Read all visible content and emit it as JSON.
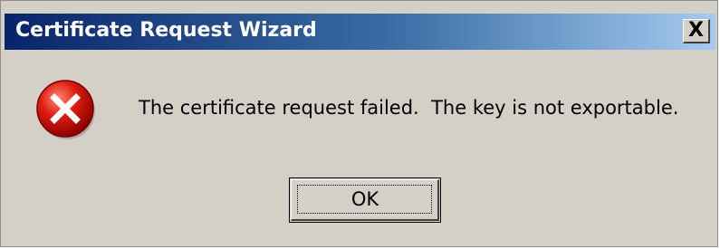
{
  "window": {
    "title": "Certificate Request Wizard",
    "close_glyph": "X"
  },
  "icon": {
    "name": "error-icon",
    "color": "#cc0000"
  },
  "message": {
    "text": "The certificate request failed.  The key is not exportable."
  },
  "buttons": {
    "ok_label": "OK"
  },
  "colors": {
    "dialog_background": "#d4d0c8",
    "titlebar_start": "#0a246a",
    "titlebar_end": "#a6caf0",
    "title_text": "#ffffff"
  }
}
